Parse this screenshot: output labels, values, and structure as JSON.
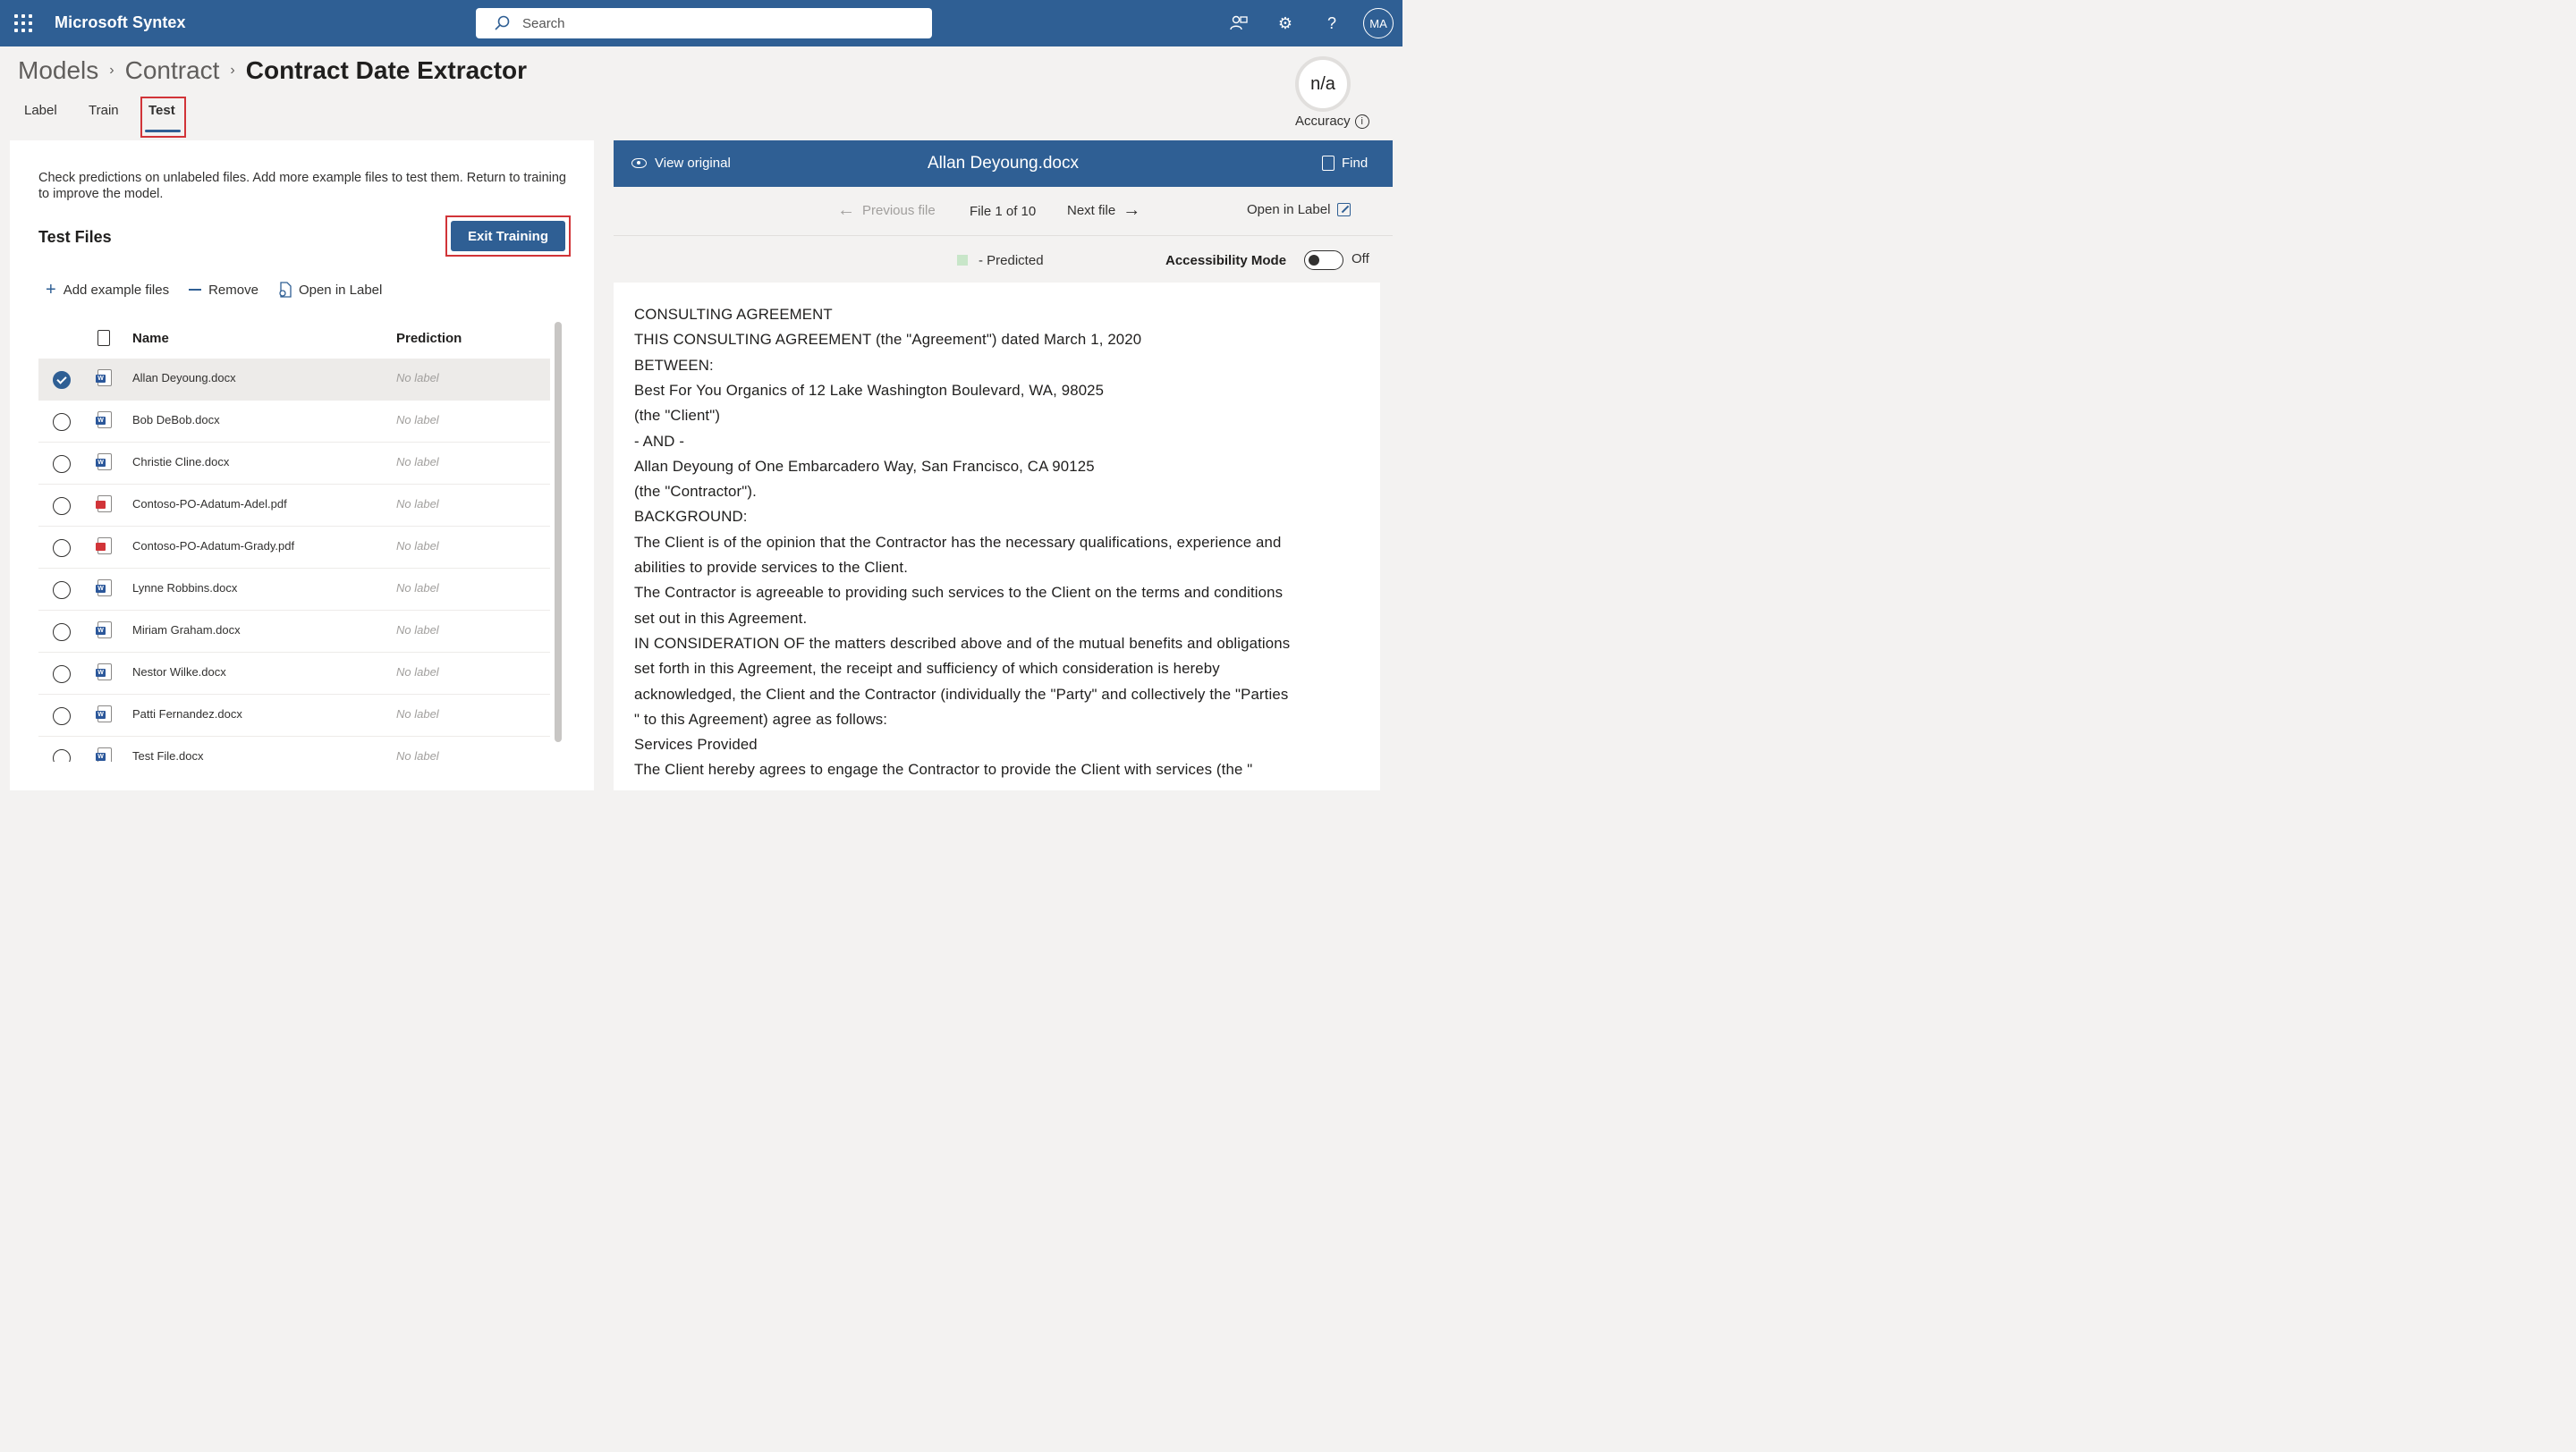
{
  "suite": {
    "app_name": "Microsoft Syntex",
    "search_placeholder": "Search",
    "user_initials": "MA"
  },
  "breadcrumb": [
    "Models",
    "Contract",
    "Contract Date Extractor"
  ],
  "tabs": [
    "Label",
    "Train",
    "Test"
  ],
  "active_tab": "Test",
  "accuracy": {
    "value": "n/a",
    "label": "Accuracy"
  },
  "left": {
    "description": "Check predictions on unlabeled files. Add more example files to test them. Return to training to improve the model.",
    "section_title": "Test Files",
    "exit_button": "Exit Training",
    "commands": {
      "add": "Add example files",
      "remove": "Remove",
      "open": "Open in Label"
    },
    "columns": {
      "name": "Name",
      "prediction": "Prediction"
    },
    "files": [
      {
        "name": "Allan Deyoung.docx",
        "prediction": "No label",
        "type": "docx",
        "selected": true
      },
      {
        "name": "Bob DeBob.docx",
        "prediction": "No label",
        "type": "docx",
        "selected": false
      },
      {
        "name": "Christie Cline.docx",
        "prediction": "No label",
        "type": "docx",
        "selected": false
      },
      {
        "name": "Contoso-PO-Adatum-Adel.pdf",
        "prediction": "No label",
        "type": "pdf",
        "selected": false
      },
      {
        "name": "Contoso-PO-Adatum-Grady.pdf",
        "prediction": "No label",
        "type": "pdf",
        "selected": false
      },
      {
        "name": "Lynne Robbins.docx",
        "prediction": "No label",
        "type": "docx",
        "selected": false
      },
      {
        "name": "Miriam Graham.docx",
        "prediction": "No label",
        "type": "docx",
        "selected": false
      },
      {
        "name": "Nestor Wilke.docx",
        "prediction": "No label",
        "type": "docx",
        "selected": false
      },
      {
        "name": "Patti Fernandez.docx",
        "prediction": "No label",
        "type": "docx",
        "selected": false
      },
      {
        "name": "Test File.docx",
        "prediction": "No label",
        "type": "docx",
        "selected": false
      }
    ]
  },
  "viewer": {
    "view_original": "View original",
    "doc_title": "Allan Deyoung.docx",
    "find": "Find",
    "previous": "Previous file",
    "file_count": "File 1 of 10",
    "next": "Next file",
    "open_in_label": "Open in Label",
    "legend": "- Predicted",
    "accessibility_mode": "Accessibility Mode",
    "toggle_state": "Off",
    "lines": [
      "CONSULTING AGREEMENT",
      "THIS CONSULTING AGREEMENT (the \"Agreement\") dated March 1, 2020",
      "BETWEEN:",
      "Best For You Organics of 12 Lake Washington Boulevard, WA, 98025",
      "(the \"Client\")",
      "- AND -",
      "Allan Deyoung of One Embarcadero Way, San Francisco, CA 90125",
      "(the \"Contractor\").",
      "BACKGROUND:",
      "The Client is of the opinion that the Contractor has the necessary qualifications, experience and",
      "abilities to provide services to the Client.",
      "The Contractor is agreeable to providing such services to the Client on the terms and conditions",
      "set out in this Agreement.",
      "IN CONSIDERATION OF the matters described above and of the mutual benefits and obligations",
      "set forth in this Agreement, the receipt and sufficiency of which consideration is hereby",
      "acknowledged, the Client and the Contractor (individually the \"Party\" and collectively the \"Parties",
      "\" to this Agreement) agree as follows:",
      "Services Provided",
      "The Client hereby agrees to engage the Contractor to provide the Client with services (the \""
    ]
  },
  "colors": {
    "brand": "#2f5f94",
    "highlight_box": "#d13438",
    "predicted_swatch": "#c8e6c9"
  }
}
